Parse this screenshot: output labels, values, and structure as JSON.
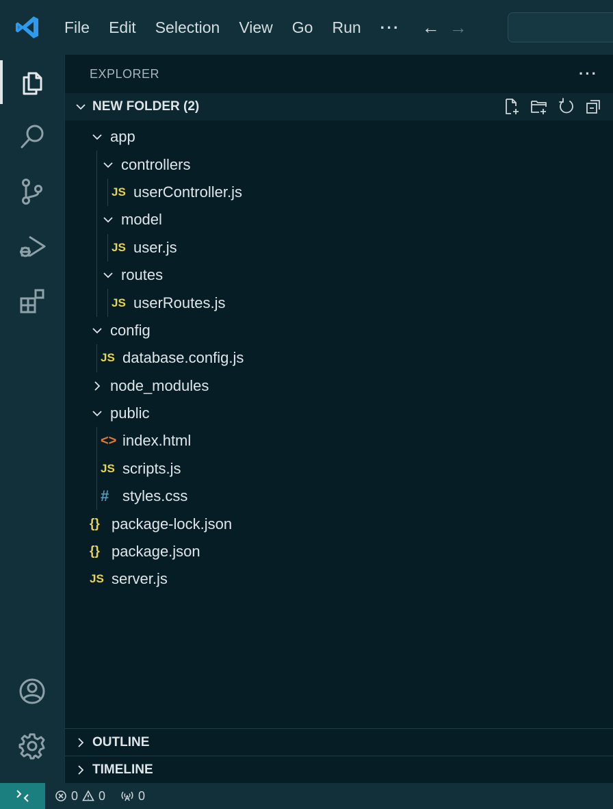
{
  "menu": {
    "items": [
      "File",
      "Edit",
      "Selection",
      "View",
      "Go",
      "Run",
      "···"
    ]
  },
  "nav": {
    "back": "←",
    "forward": "→"
  },
  "activity": {
    "icons": [
      "files-icon",
      "search-icon",
      "source-control-icon",
      "run-debug-icon",
      "extensions-icon",
      "account-icon",
      "manage-gear-icon"
    ]
  },
  "explorer": {
    "title": "EXPLORER",
    "more": "···",
    "folder": "NEW FOLDER (2)",
    "tree": [
      {
        "label": "app",
        "type": "folder",
        "depth": 1,
        "open": true
      },
      {
        "label": "controllers",
        "type": "folder",
        "depth": 2,
        "open": true
      },
      {
        "label": "userController.js",
        "type": "js",
        "depth": 3
      },
      {
        "label": "model",
        "type": "folder",
        "depth": 2,
        "open": true
      },
      {
        "label": "user.js",
        "type": "js",
        "depth": 3
      },
      {
        "label": "routes",
        "type": "folder",
        "depth": 2,
        "open": true
      },
      {
        "label": "userRoutes.js",
        "type": "js",
        "depth": 3
      },
      {
        "label": "config",
        "type": "folder",
        "depth": 1,
        "open": true
      },
      {
        "label": "database.config.js",
        "type": "js",
        "depth": 2
      },
      {
        "label": "node_modules",
        "type": "folder",
        "depth": 1,
        "open": false
      },
      {
        "label": "public",
        "type": "folder",
        "depth": 1,
        "open": true
      },
      {
        "label": "index.html",
        "type": "html",
        "depth": 2
      },
      {
        "label": "scripts.js",
        "type": "js",
        "depth": 2
      },
      {
        "label": "styles.css",
        "type": "css",
        "depth": 2
      },
      {
        "label": "package-lock.json",
        "type": "json",
        "depth": 1
      },
      {
        "label": "package.json",
        "type": "json",
        "depth": 1
      },
      {
        "label": "server.js",
        "type": "js",
        "depth": 1
      }
    ]
  },
  "panels": {
    "outline": "OUTLINE",
    "timeline": "TIMELINE"
  },
  "status": {
    "errors": "0",
    "warnings": "0",
    "ports": "0"
  },
  "icon_glyphs": {
    "js": "JS",
    "html": "<>",
    "css": "#",
    "json": "{}"
  }
}
